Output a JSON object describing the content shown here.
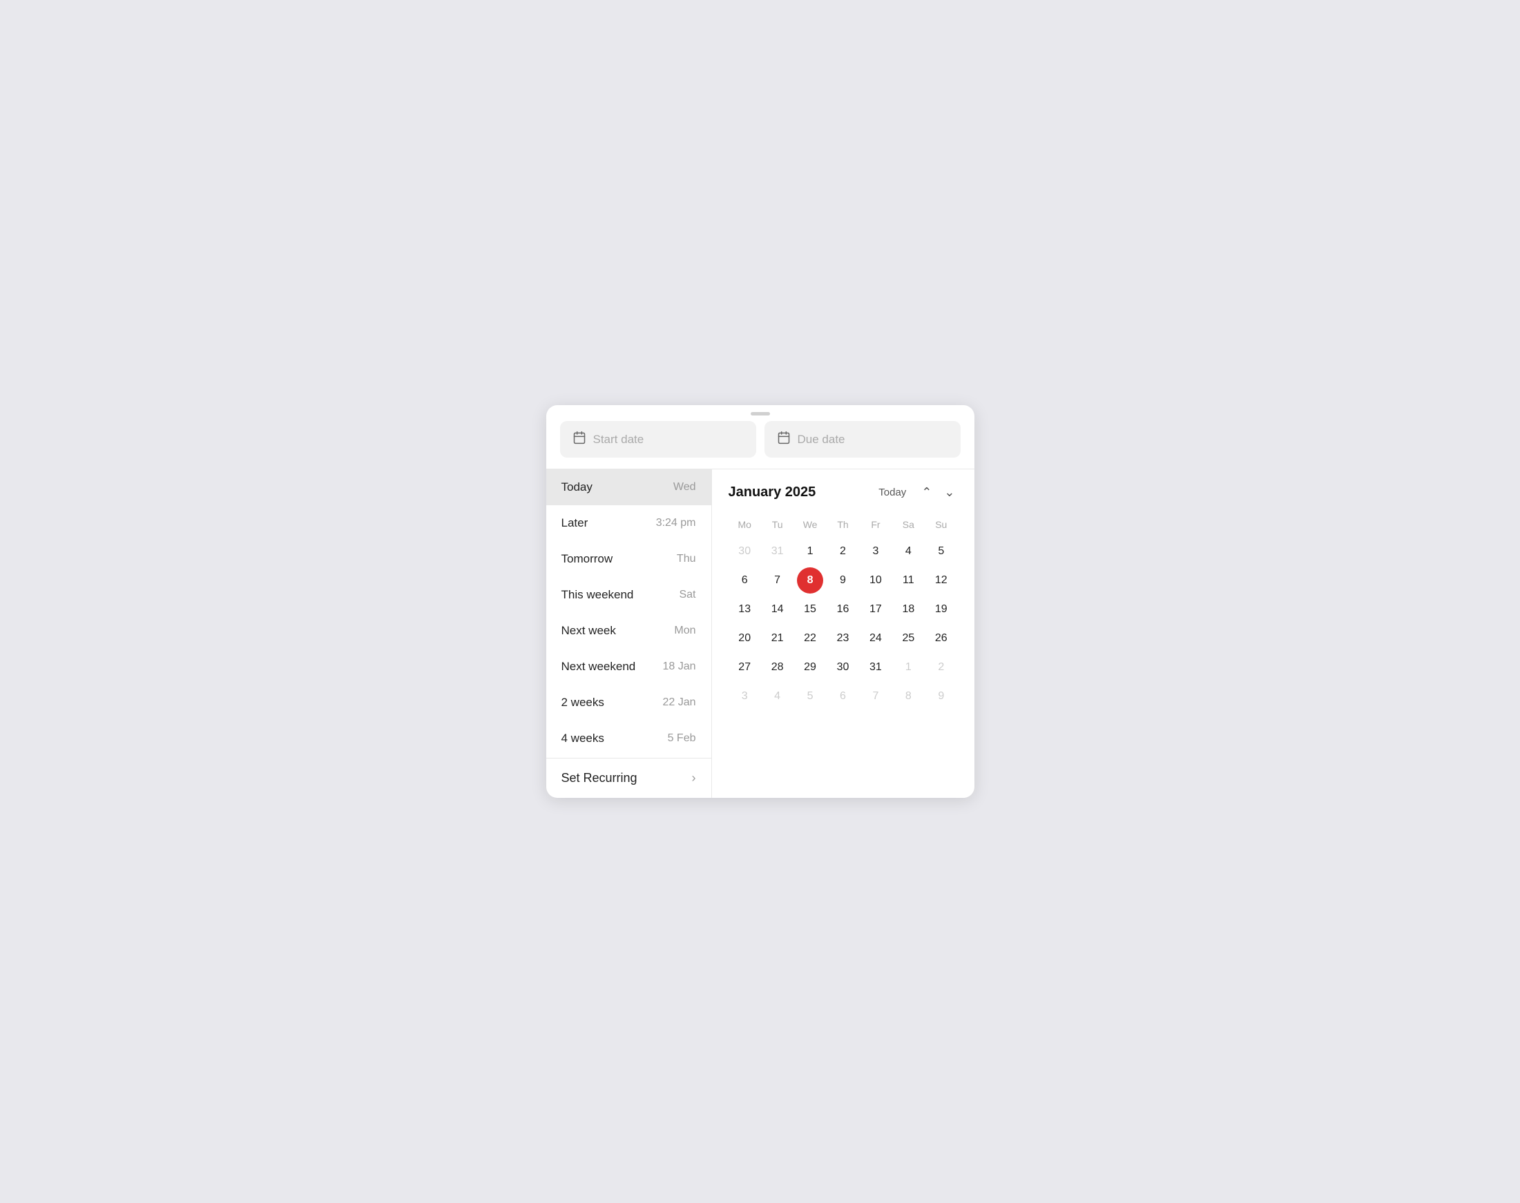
{
  "dateInputs": {
    "startDate": {
      "label": "Start date",
      "icon": "📅"
    },
    "dueDate": {
      "label": "Due date",
      "icon": "📅"
    }
  },
  "quickOptions": [
    {
      "id": "today",
      "label": "Today",
      "value": "Wed",
      "active": true
    },
    {
      "id": "later",
      "label": "Later",
      "value": "3:24 pm",
      "active": false
    },
    {
      "id": "tomorrow",
      "label": "Tomorrow",
      "value": "Thu",
      "active": false
    },
    {
      "id": "this-weekend",
      "label": "This weekend",
      "value": "Sat",
      "active": false
    },
    {
      "id": "next-week",
      "label": "Next week",
      "value": "Mon",
      "active": false
    },
    {
      "id": "next-weekend",
      "label": "Next weekend",
      "value": "18 Jan",
      "active": false
    },
    {
      "id": "2-weeks",
      "label": "2 weeks",
      "value": "22 Jan",
      "active": false
    },
    {
      "id": "4-weeks",
      "label": "4 weeks",
      "value": "5 Feb",
      "active": false
    }
  ],
  "setRecurring": {
    "label": "Set Recurring",
    "chevron": "›"
  },
  "calendar": {
    "monthYear": "January 2025",
    "todayButton": "Today",
    "weekdays": [
      "Mo",
      "Tu",
      "We",
      "Th",
      "Fr",
      "Sa",
      "Su"
    ],
    "weeks": [
      [
        {
          "day": "30",
          "outside": true
        },
        {
          "day": "31",
          "outside": true
        },
        {
          "day": "1",
          "outside": false
        },
        {
          "day": "2",
          "outside": false
        },
        {
          "day": "3",
          "outside": false
        },
        {
          "day": "4",
          "outside": false
        },
        {
          "day": "5",
          "outside": false
        }
      ],
      [
        {
          "day": "6",
          "outside": false
        },
        {
          "day": "7",
          "outside": false
        },
        {
          "day": "8",
          "outside": false,
          "today": true
        },
        {
          "day": "9",
          "outside": false
        },
        {
          "day": "10",
          "outside": false
        },
        {
          "day": "11",
          "outside": false
        },
        {
          "day": "12",
          "outside": false
        }
      ],
      [
        {
          "day": "13",
          "outside": false
        },
        {
          "day": "14",
          "outside": false
        },
        {
          "day": "15",
          "outside": false
        },
        {
          "day": "16",
          "outside": false
        },
        {
          "day": "17",
          "outside": false
        },
        {
          "day": "18",
          "outside": false
        },
        {
          "day": "19",
          "outside": false
        }
      ],
      [
        {
          "day": "20",
          "outside": false
        },
        {
          "day": "21",
          "outside": false
        },
        {
          "day": "22",
          "outside": false
        },
        {
          "day": "23",
          "outside": false
        },
        {
          "day": "24",
          "outside": false
        },
        {
          "day": "25",
          "outside": false
        },
        {
          "day": "26",
          "outside": false
        }
      ],
      [
        {
          "day": "27",
          "outside": false
        },
        {
          "day": "28",
          "outside": false
        },
        {
          "day": "29",
          "outside": false
        },
        {
          "day": "30",
          "outside": false
        },
        {
          "day": "31",
          "outside": false
        },
        {
          "day": "1",
          "outside": true
        },
        {
          "day": "2",
          "outside": true
        }
      ],
      [
        {
          "day": "3",
          "outside": true
        },
        {
          "day": "4",
          "outside": true
        },
        {
          "day": "5",
          "outside": true
        },
        {
          "day": "6",
          "outside": true
        },
        {
          "day": "7",
          "outside": true
        },
        {
          "day": "8",
          "outside": true
        },
        {
          "day": "9",
          "outside": true
        }
      ]
    ]
  }
}
